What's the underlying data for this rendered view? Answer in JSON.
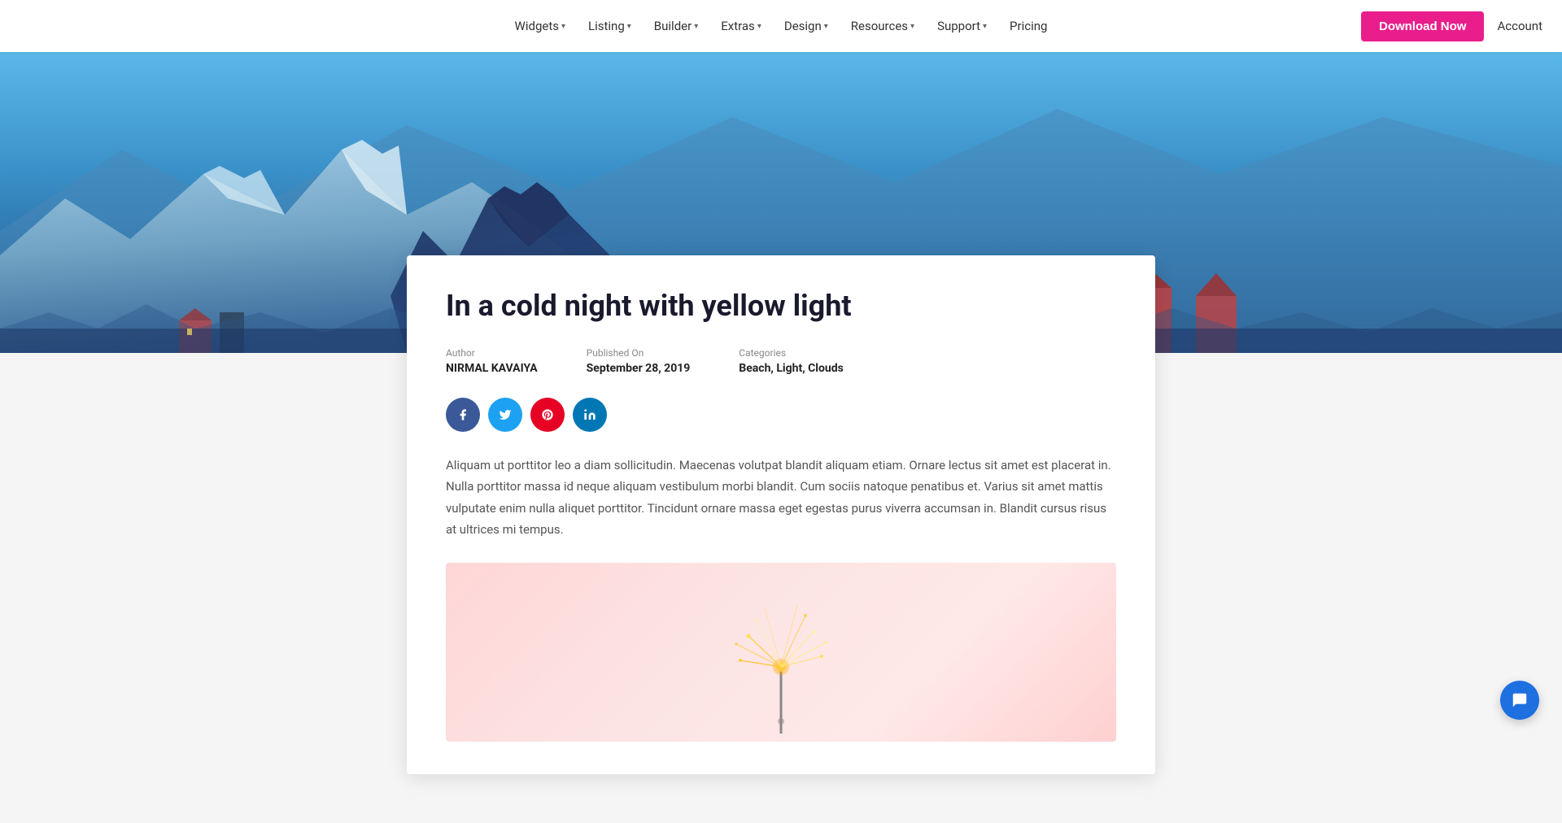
{
  "nav": {
    "items": [
      {
        "label": "Widgets",
        "hasDropdown": true
      },
      {
        "label": "Listing",
        "hasDropdown": true
      },
      {
        "label": "Builder",
        "hasDropdown": true
      },
      {
        "label": "Extras",
        "hasDropdown": true
      },
      {
        "label": "Design",
        "hasDropdown": true
      },
      {
        "label": "Resources",
        "hasDropdown": true
      },
      {
        "label": "Support",
        "hasDropdown": true
      },
      {
        "label": "Pricing",
        "hasDropdown": false
      }
    ],
    "download_label": "Download Now",
    "account_label": "Account"
  },
  "article": {
    "title": "In a cold night with yellow light",
    "meta": {
      "author_label": "Author",
      "author_value": "NIRMAL KAVAIYA",
      "published_label": "Published On",
      "published_value": "September 28, 2019",
      "categories_label": "Categories",
      "categories_value": "Beach, Light, Clouds"
    },
    "body": "Aliquam ut porttitor leo a diam sollicitudin. Maecenas volutpat blandit aliquam etiam. Ornare lectus sit amet est placerat in. Nulla porttitor massa id neque aliquam vestibulum morbi blandit. Cum sociis natoque penatibus et. Varius sit amet mattis vulputate enim nulla aliquet porttitor. Tincidunt ornare massa eget egestas purus viverra accumsan in. Blandit cursus risus at ultrices mi tempus.",
    "social": {
      "facebook": "f",
      "twitter": "t",
      "pinterest": "p",
      "linkedin": "in"
    }
  }
}
